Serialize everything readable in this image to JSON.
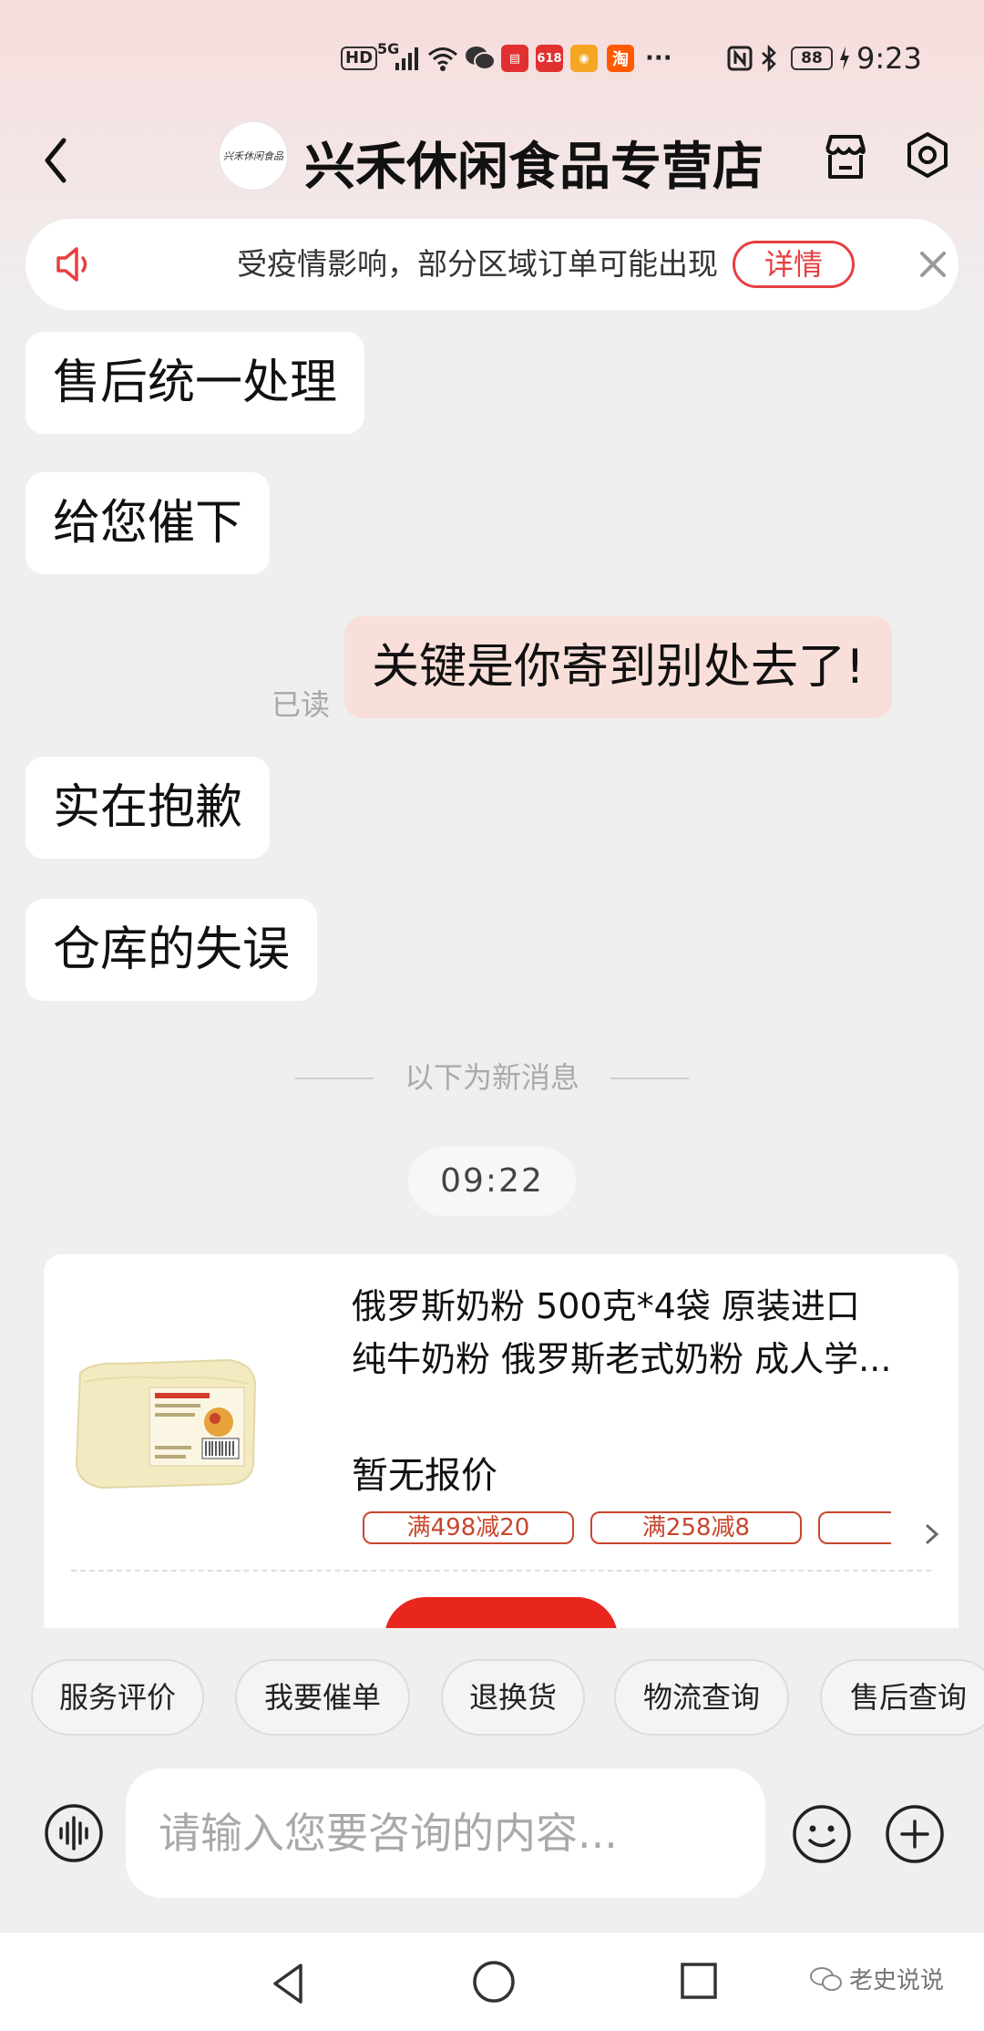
{
  "status_bar": {
    "hd": "HD",
    "network": "5G",
    "time": "9:23",
    "battery": "88",
    "app_618_a": "618",
    "app_taobao": "淘",
    "more": "···",
    "icons": [
      "hd-icon",
      "signal-icon",
      "wifi-icon",
      "wechat-icon",
      "app-icon",
      "weibo-icon",
      "taobao-icon",
      "nfc-icon",
      "bluetooth-icon",
      "battery-icon"
    ]
  },
  "header": {
    "shop_logo_text": "兴禾休闲食品",
    "title": "兴禾休闲食品专营店"
  },
  "notice": {
    "text": "受疫情影响，部分区域订单可能出现",
    "detail_label": "详情"
  },
  "messages": [
    {
      "side": "them",
      "text": "售后统一处理"
    },
    {
      "side": "them",
      "text": "给您催下"
    },
    {
      "side": "me",
      "text": "关键是你寄到别处去了!",
      "read": "已读"
    },
    {
      "side": "them",
      "text": "实在抱歉"
    },
    {
      "side": "them",
      "text": "仓库的失误"
    }
  ],
  "new_messages_divider": "以下为新消息",
  "timestamp": "09:22",
  "product": {
    "title_line1": "俄罗斯奶粉  500克*4袋  原装进口",
    "title_line2": "纯牛奶粉  俄罗斯老式奶粉  成人学...",
    "price": "暂无报价",
    "coupons": [
      "满498减20",
      "满258减8"
    ]
  },
  "quick_actions": [
    "服务评价",
    "我要催单",
    "退换货",
    "物流查询",
    "售后查询"
  ],
  "input": {
    "placeholder": "请输入您要咨询的内容..."
  },
  "watermark": "老史说说",
  "colors": {
    "accent": "#e64040",
    "my_bubble": "#f8dfda",
    "coupon": "#c8452c",
    "action_button": "#e8261e"
  }
}
